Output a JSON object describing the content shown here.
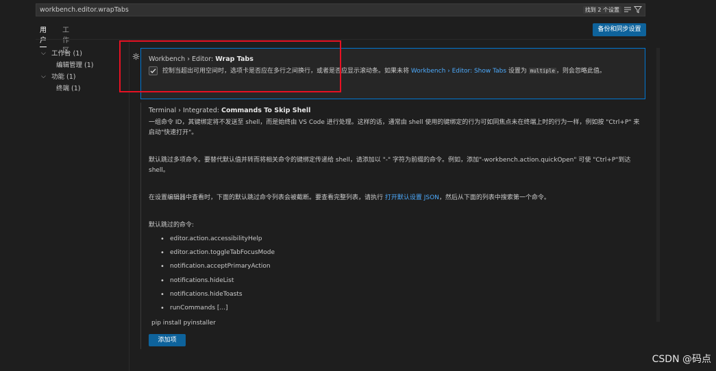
{
  "search": {
    "value": "workbench.editor.wrapTabs",
    "result_badge": "找到 2 个设置",
    "clear_filters_icon": "list-filter-icon",
    "filter_icon": "funnel-icon"
  },
  "scope_tabs": [
    {
      "label": "用户",
      "active": true
    },
    {
      "label": "工作区",
      "active": false
    }
  ],
  "sync_button": "备份和同步设置",
  "toc": [
    {
      "label": "工作台 (1)",
      "expanded": true,
      "level": 0
    },
    {
      "label": "编辑管理 (1)",
      "level": 1
    },
    {
      "label": "功能 (1)",
      "expanded": true,
      "level": 0
    },
    {
      "label": "终端 (1)",
      "level": 1
    }
  ],
  "settings": {
    "wrap_tabs": {
      "category": "Workbench › Editor: ",
      "name": "Wrap Tabs",
      "checked": true,
      "desc_part1": "控制当超出可用空间时，选项卡是否应在多行之间换行，或者是否应显示滚动条。如果未将 ",
      "desc_link": "Workbench › Editor: Show Tabs",
      "desc_part2": " 设置为 ",
      "desc_code": "multiple",
      "desc_part3": "，则会忽略此值。"
    },
    "commands_to_skip_shell": {
      "category": "Terminal › Integrated: ",
      "name": "Commands To Skip Shell",
      "para1": "一组命令 ID，其键绑定将不发送至 shell，而是始终由 VS Code 进行处理。这样的话，通常由 shell 使用的键绑定的行为可如同焦点未在终端上时的行为一样，例如按 \"Ctrl+P\" 来启动\"快速打开\"。",
      "para2": "默认跳过多项命令。要替代默认值并转而将相关命令的键绑定传递给 shell，请添加以 \"-\" 字符为前缀的命令。例如，添加\"-workbench.action.quickOpen\" 可使 \"Ctrl+P\"到达 shell。",
      "para3_part1": "在设置编辑器中查看时，下面的默认跳过命令列表会被截断。要查看完整列表，请执行 ",
      "para3_link": "打开默认设置 JSON",
      "para3_part2": "，然后从下面的列表中搜索第一个命令。",
      "list_heading": "默认跳过的命令:",
      "commands": [
        "editor.action.accessibilityHelp",
        "editor.action.toggleTabFocusMode",
        "notification.acceptPrimaryAction",
        "notifications.hideList",
        "notifications.hideToasts",
        "runCommands [...]"
      ],
      "value_item": "pip install pyinstaller",
      "add_button": "添加项"
    }
  },
  "watermark": "CSDN @码点",
  "colors": {
    "accent": "#0078d4",
    "button": "#0e639c",
    "link": "#4daafc",
    "highlight_box": "#e81123"
  }
}
